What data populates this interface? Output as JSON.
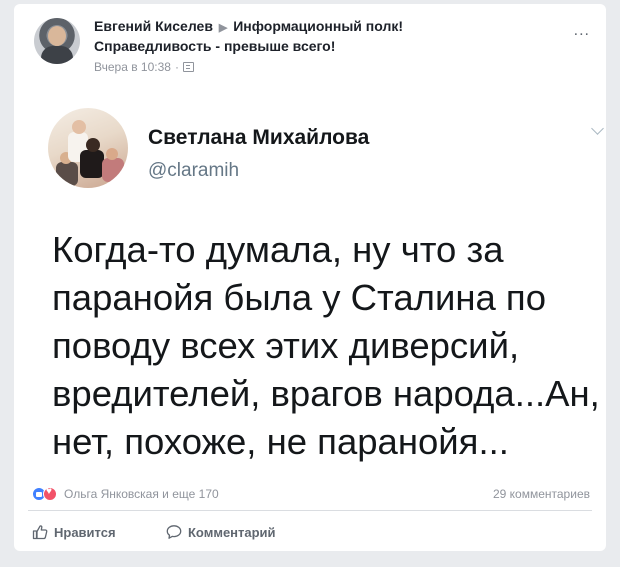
{
  "post": {
    "author": "Евгений Киселев",
    "arrow": "▶",
    "group": "Информационный полк!",
    "group_line2": "Справедливость - превыше всего!",
    "time": "Вчера в 10:38",
    "separator": "·",
    "more": "..."
  },
  "tweet": {
    "name": "Светлана Михайлова",
    "handle": "@claramih",
    "lines": [
      "Когда-то думала, ну что за",
      "паранойя была у Сталина по",
      "поводу всех этих диверсий,",
      "вредителей, врагов народа...Ан,",
      "нет, похоже, не паранойя..."
    ]
  },
  "stats": {
    "reactions_text": "Ольга Янковская и еще 170",
    "comments_text": "29 комментариев"
  },
  "actions": {
    "like_label": "Нравится",
    "comment_label": "Комментарий"
  },
  "colors": {
    "like_blue": "#4080ff",
    "love_red": "#f25268",
    "text_secondary": "#90949c"
  }
}
